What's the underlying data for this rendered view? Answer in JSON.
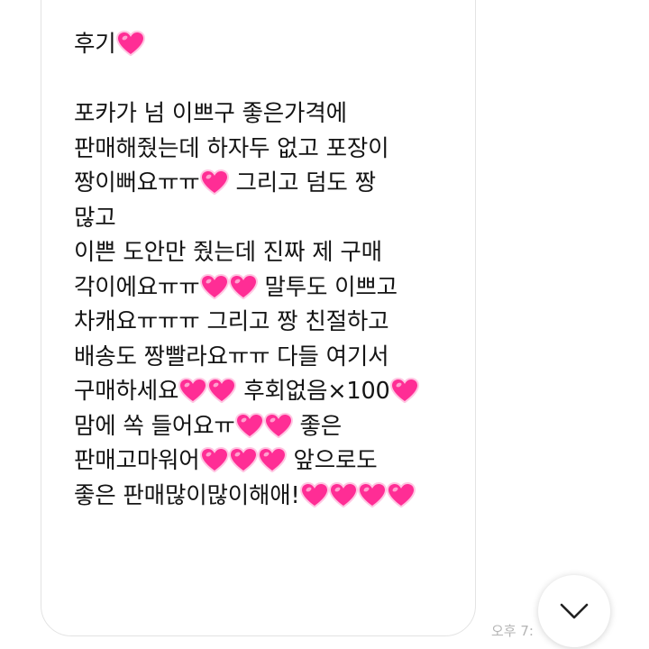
{
  "message": {
    "lines": [
      {
        "parts": [
          "후기",
          "heart"
        ]
      },
      {
        "parts": []
      },
      {
        "parts": [
          "포카가 넘 이쁘구 좋은가격에"
        ]
      },
      {
        "parts": [
          "판매해줬는데 하자두 없고 포장이"
        ]
      },
      {
        "parts": [
          "짱이뻐요ㅠㅠ",
          "heart",
          " 그리고 덤도 짱"
        ]
      },
      {
        "parts": [
          "많고"
        ]
      },
      {
        "parts": [
          "이쁜 도안만 줬는데 진짜 제 구매"
        ]
      },
      {
        "parts": [
          "각이에요ㅠㅠ",
          "heart",
          "heart",
          " 말투도 이쁘고"
        ]
      },
      {
        "parts": [
          "차캐요ㅠㅠㅠ 그리고 짱 친절하고"
        ]
      },
      {
        "parts": [
          "배송도 짱빨라요ㅠㅠ 다들 여기서"
        ]
      },
      {
        "parts": [
          "구매하세요",
          "heart",
          "heart",
          " 후회없음×100",
          "heart"
        ]
      },
      {
        "parts": [
          "맘에 쏙 들어요ㅠ",
          "heart",
          "heart",
          " 좋은"
        ]
      },
      {
        "parts": [
          "판매고마워어",
          "heart",
          "heart",
          "heart",
          " 앞으로도"
        ]
      },
      {
        "parts": [
          "좋은 판매많이많이해애!",
          "heart",
          "heart",
          "heart",
          "heart"
        ]
      }
    ],
    "heart_icon": "pink-heart-emoji",
    "heart_color": "#ff2d95",
    "heart_glow_color": "#ffb3d9"
  },
  "timestamp": "오후 7:",
  "scroll_button": {
    "icon": "chevron-down-icon"
  },
  "colors": {
    "background": "#ffffff",
    "bubble_border": "#e3e3e3",
    "text": "#141414",
    "timestamp": "#b4b4b4"
  }
}
